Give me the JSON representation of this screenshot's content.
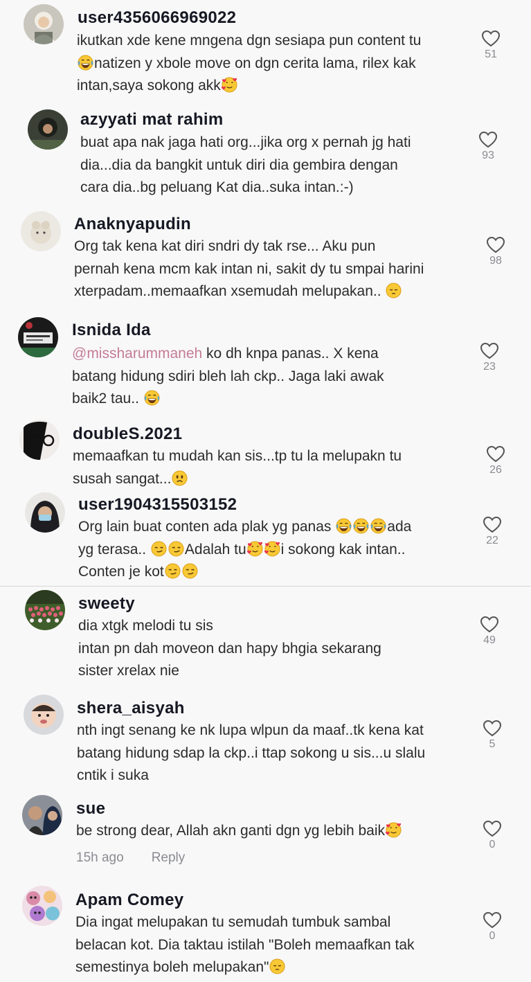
{
  "comments": [
    {
      "username": "user4356066969022",
      "lines": [
        {
          "segments": [
            {
              "t": "ikutkan xde kene mngena dgn sesiapa pun content tu"
            }
          ]
        },
        {
          "segments": [
            {
              "emoji": "joy"
            },
            {
              "t": "natizen y xbole move on dgn cerita lama, rilex kak"
            }
          ]
        },
        {
          "segments": [
            {
              "t": "intan,saya sokong akk"
            },
            {
              "emoji": "hearts"
            }
          ]
        }
      ],
      "likes": "51",
      "avatar": "avatar-hijab-bride"
    },
    {
      "username": "azyyati mat rahim",
      "lines": [
        {
          "segments": [
            {
              "t": "buat apa nak jaga hati org...jika org x pernah jg hati"
            }
          ]
        },
        {
          "segments": [
            {
              "t": "dia...dia da bangkit untuk diri dia gembira dengan"
            }
          ]
        },
        {
          "segments": [
            {
              "t": "cara dia..bg peluang Kat dia..suka intan.:-)"
            }
          ]
        }
      ],
      "likes": "93",
      "avatar": "avatar-dark-hijab"
    },
    {
      "username": "Anaknyapudin",
      "lines": [
        {
          "segments": [
            {
              "t": "Org tak kena kat diri sndri dy tak rse... Aku pun"
            }
          ]
        },
        {
          "segments": [
            {
              "t": "pernah kena mcm kak intan ni, sakit dy tu smpai harini"
            }
          ]
        },
        {
          "segments": [
            {
              "t": "xterpadam..memaafkan xsemudah melupakan.. "
            },
            {
              "emoji": "pensive"
            }
          ]
        }
      ],
      "likes": "98",
      "avatar": "avatar-cat-plush"
    },
    {
      "username": "Isnida Ida",
      "lines": [
        {
          "segments": [
            {
              "mention": "@missharummaneh"
            },
            {
              "t": " ko dh knpa panas.. X kena"
            }
          ]
        },
        {
          "segments": [
            {
              "t": "batang hidung sdiri bleh lah ckp.. Jaga laki awak"
            }
          ]
        },
        {
          "segments": [
            {
              "t": "baik2 tau.. "
            },
            {
              "emoji": "joy"
            }
          ]
        }
      ],
      "likes": "23",
      "avatar": "avatar-name-badge"
    },
    {
      "username": "doubleS.2021",
      "lines": [
        {
          "segments": [
            {
              "t": "memaafkan tu mudah kan sis...tp tu la melupakn tu"
            }
          ]
        },
        {
          "segments": [
            {
              "t": "susah sangat..."
            },
            {
              "emoji": "frown"
            }
          ]
        }
      ],
      "likes": "26",
      "avatar": "avatar-glasses"
    },
    {
      "username": "user1904315503152",
      "lines": [
        {
          "segments": [
            {
              "t": "Org lain buat conten ada plak yg panas "
            },
            {
              "emoji": "joy"
            },
            {
              "emoji": "joy"
            },
            {
              "emoji": "joy"
            },
            {
              "t": "ada"
            }
          ]
        },
        {
          "segments": [
            {
              "t": "yg terasa.. "
            },
            {
              "emoji": "smirk"
            },
            {
              "emoji": "smirk"
            },
            {
              "t": "Adalah tu"
            },
            {
              "emoji": "hearts"
            },
            {
              "emoji": "hearts"
            },
            {
              "t": "i sokong kak intan.."
            }
          ]
        },
        {
          "segments": [
            {
              "t": "Conten je kot"
            },
            {
              "emoji": "smirk"
            },
            {
              "emoji": "smirk"
            }
          ]
        }
      ],
      "likes": "22",
      "avatar": "avatar-mask"
    },
    {
      "username": "sweety",
      "lines": [
        {
          "segments": [
            {
              "t": "dia xtgk melodi tu sis"
            }
          ]
        },
        {
          "segments": [
            {
              "t": "intan pn dah moveon dan hapy bhgia sekarang"
            }
          ]
        },
        {
          "segments": [
            {
              "t": "sister xrelax nie"
            }
          ]
        }
      ],
      "likes": "49",
      "avatar": "avatar-tulips"
    },
    {
      "username": "shera_aisyah",
      "lines": [
        {
          "segments": [
            {
              "t": "nth ingt senang ke nk lupa wlpun da maaf..tk kena kat"
            }
          ]
        },
        {
          "segments": [
            {
              "t": "batang hidung sdap la ckp..i ttap sokong u sis...u slalu"
            }
          ]
        },
        {
          "segments": [
            {
              "t": "cntik i suka"
            }
          ]
        }
      ],
      "likes": "5",
      "avatar": "avatar-baby"
    },
    {
      "username": "sue",
      "lines": [
        {
          "segments": [
            {
              "t": "be strong dear, Allah akn ganti dgn yg lebih baik"
            },
            {
              "emoji": "hearts"
            }
          ]
        }
      ],
      "likes": "0",
      "time": "15h ago",
      "reply": "Reply",
      "avatar": "avatar-couple"
    },
    {
      "username": "Apam Comey",
      "lines": [
        {
          "segments": [
            {
              "t": "Dia ingat melupakan tu semudah tumbuk sambal"
            }
          ]
        },
        {
          "segments": [
            {
              "t": "belacan kot. Dia taktau istilah \"Boleh memaafkan tak"
            }
          ]
        },
        {
          "segments": [
            {
              "t": "semestinya boleh melupakan\""
            },
            {
              "emoji": "pensive"
            }
          ]
        }
      ],
      "likes": "0",
      "avatar": "avatar-cartoon-collage"
    }
  ],
  "colors": {
    "background": "#f8f8f8",
    "username": "#161823",
    "text": "#2b2b2b",
    "meta": "#8a8b91",
    "mention": "#c57b97"
  }
}
